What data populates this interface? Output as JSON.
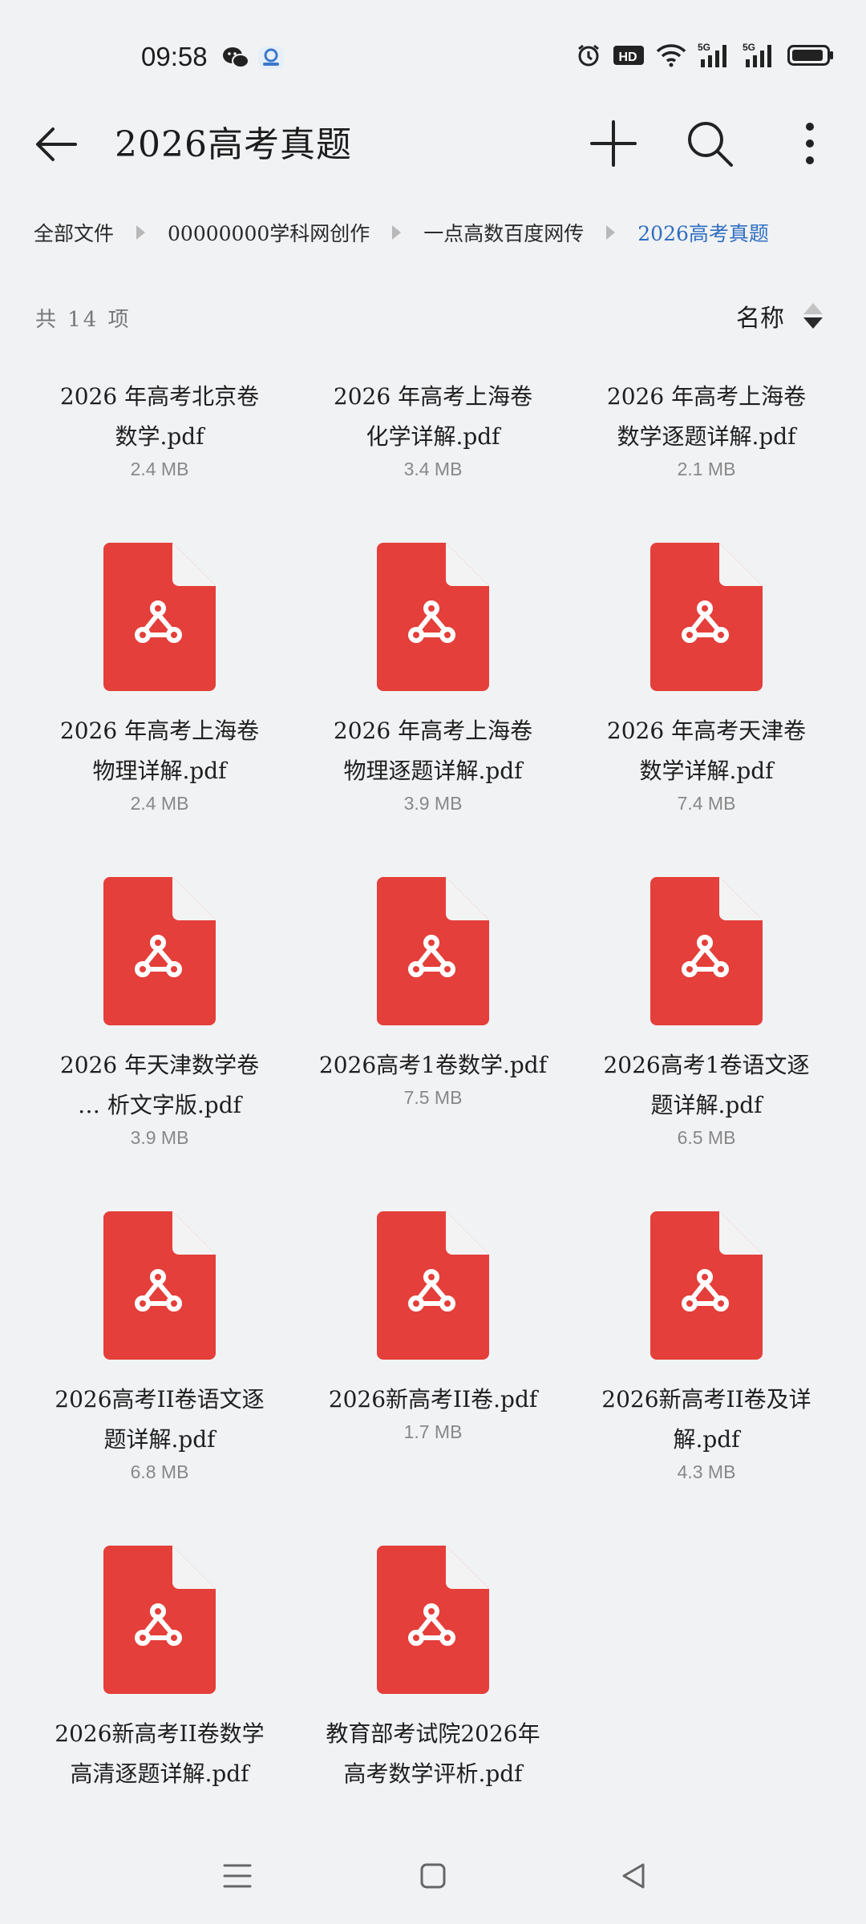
{
  "status_bar": {
    "time": "09:58",
    "app_icons": [
      "wechat-icon",
      "app-notification-icon"
    ],
    "right_icons": [
      "alarm-icon",
      "hd-icon",
      "wifi-icon",
      "signal-5g-icon",
      "signal-5g-icon",
      "battery-icon"
    ],
    "network_label": "5G",
    "hd_label": "HD"
  },
  "app_bar": {
    "title": "2026高考真题",
    "back_icon": "arrow-left-icon",
    "add_icon": "plus-icon",
    "search_icon": "search-icon",
    "more_icon": "more-vertical-icon"
  },
  "breadcrumb": [
    "全部文件",
    "00000000学科网创作",
    "一点高数百度网传",
    "2026高考真题"
  ],
  "list_header": {
    "count": "共 14 项",
    "sort_label": "名称"
  },
  "colors": {
    "pdf_red": "#e43f3a",
    "pdf_fold": "#f3f3f3",
    "accent": "#2f6ec1"
  },
  "files": [
    {
      "name_lines": [
        "2026 年高考北京卷",
        "数学.pdf"
      ],
      "size": "2.4 MB"
    },
    {
      "name_lines": [
        "2026 年高考上海卷",
        "化学详解.pdf"
      ],
      "size": "3.4 MB"
    },
    {
      "name_lines": [
        "2026 年高考上海卷",
        "数学逐题详解.pdf"
      ],
      "size": "2.1 MB"
    },
    {
      "name_lines": [
        "2026 年高考上海卷",
        "物理详解.pdf"
      ],
      "size": "2.4 MB"
    },
    {
      "name_lines": [
        "2026 年高考上海卷",
        "物理逐题详解.pdf"
      ],
      "size": "3.9 MB"
    },
    {
      "name_lines": [
        "2026 年高考天津卷",
        "数学详解.pdf"
      ],
      "size": "7.4 MB"
    },
    {
      "name_lines": [
        "2026 年天津数学卷",
        "… 析文字版.pdf"
      ],
      "size": "3.9 MB"
    },
    {
      "name_lines": [
        "2026高考1卷数学.pdf"
      ],
      "size": "7.5 MB"
    },
    {
      "name_lines": [
        "2026高考1卷语文逐",
        "题详解.pdf"
      ],
      "size": "6.5 MB"
    },
    {
      "name_lines": [
        "2026高考II卷语文逐",
        "题详解.pdf"
      ],
      "size": "6.8 MB"
    },
    {
      "name_lines": [
        "2026新高考II卷.pdf"
      ],
      "size": "1.7 MB"
    },
    {
      "name_lines": [
        "2026新高考II卷及详",
        "解.pdf"
      ],
      "size": "4.3 MB"
    },
    {
      "name_lines": [
        "2026新高考II卷数学",
        "高清逐题详解.pdf"
      ],
      "size": ""
    },
    {
      "name_lines": [
        "教育部考试院2026年",
        "高考数学评析.pdf"
      ],
      "size": ""
    }
  ],
  "nav_bar": {
    "icons": [
      "menu-icon",
      "home-square-icon",
      "back-triangle-icon"
    ]
  }
}
